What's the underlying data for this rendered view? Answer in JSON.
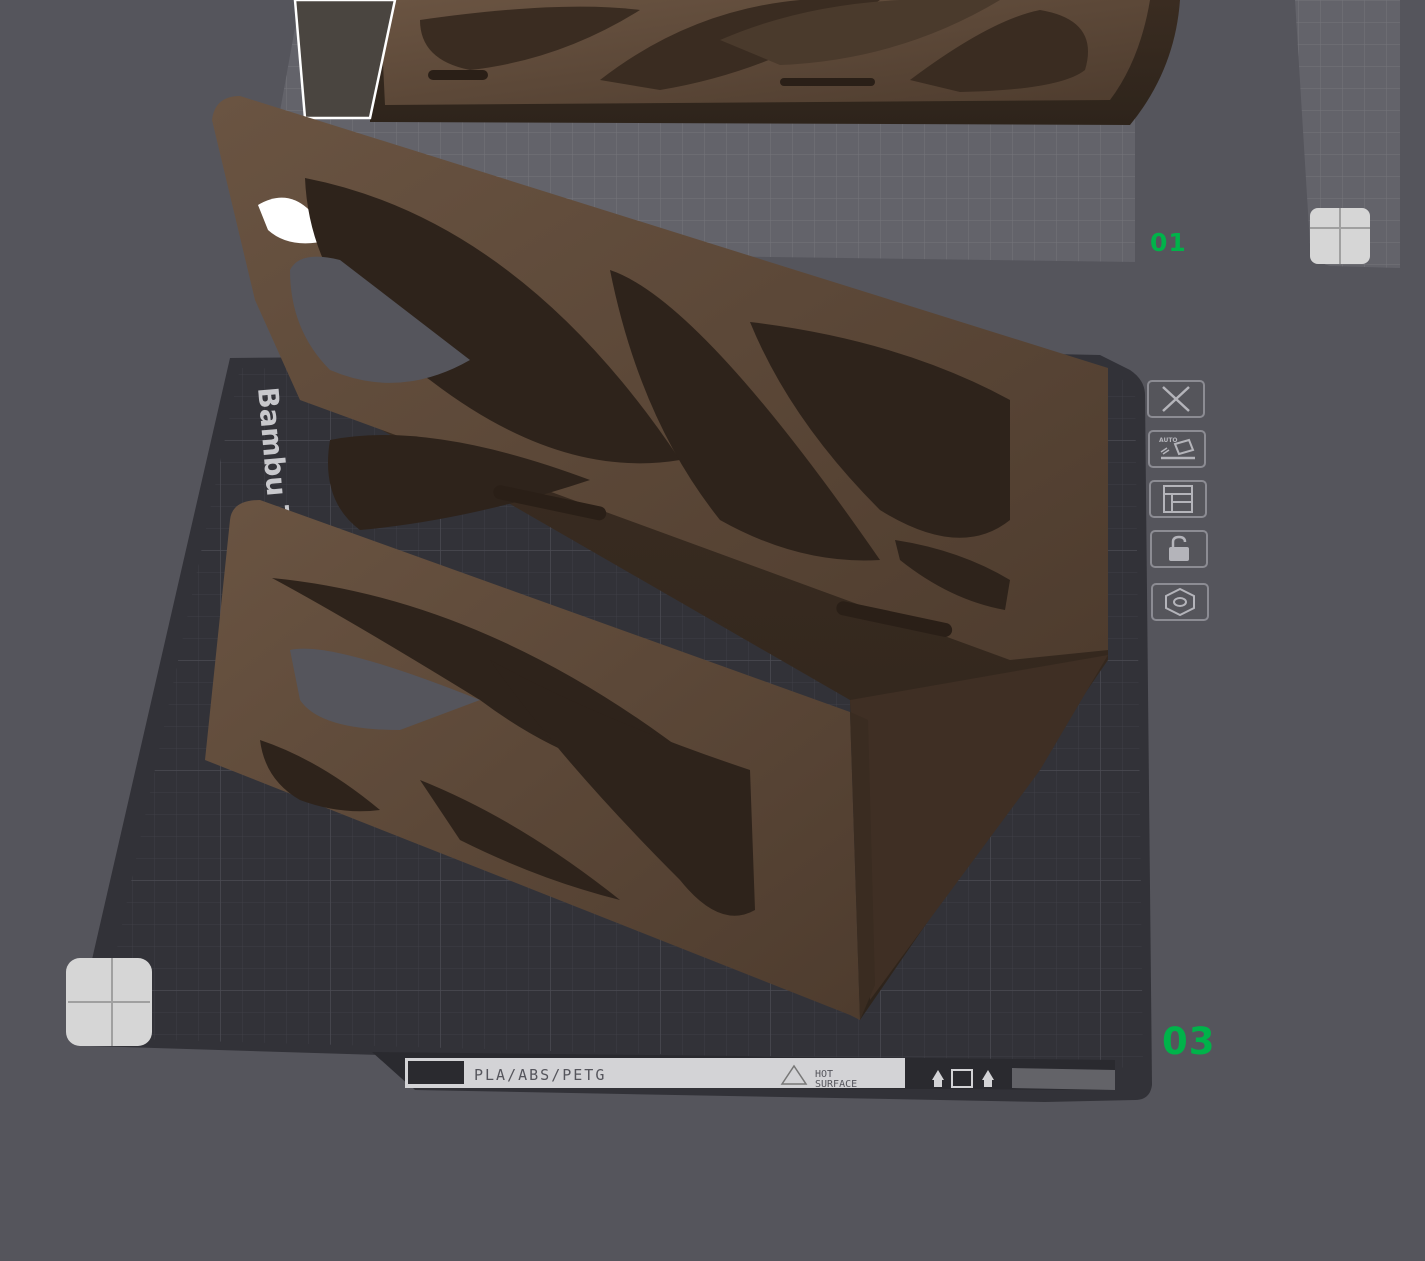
{
  "viewport": {
    "background_color": "#55555c",
    "model_color": "#5e4a39"
  },
  "plates": {
    "plate_01": {
      "number": "01"
    },
    "plate_03": {
      "number": "03",
      "bed_label": "Bambu Textured PEI Plate",
      "material_label": "PLA/ABS/PETG",
      "warning_label_line1": "HOT",
      "warning_label_line2": "SURFACE"
    }
  },
  "plate_toolbar": {
    "buttons": [
      {
        "name": "delete-plate",
        "icon": "close-icon"
      },
      {
        "name": "auto-orient",
        "icon": "auto-orient-icon",
        "label": "AUTO"
      },
      {
        "name": "arrange",
        "icon": "arrange-icon"
      },
      {
        "name": "lock",
        "icon": "lock-icon"
      },
      {
        "name": "plate-settings",
        "icon": "hexagon-settings-icon"
      }
    ]
  },
  "accent_colors": {
    "plate_number": "#00b34a",
    "icon_stroke": "#b4b4ba"
  }
}
